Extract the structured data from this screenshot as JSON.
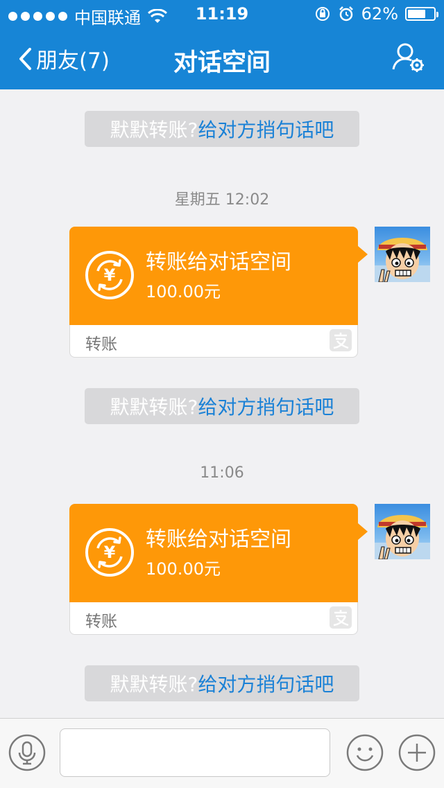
{
  "status_bar": {
    "carrier": "中国联通",
    "time": "11:19",
    "battery_text": "62%",
    "battery_level": 0.62
  },
  "nav": {
    "back_label": "朋友(7)",
    "title": "对话空间"
  },
  "prompts": [
    {
      "gray": "默默转账?",
      "link": "给对方捎句话吧"
    },
    {
      "gray": "默默转账?",
      "link": "给对方捎句话吧"
    },
    {
      "gray": "默默转账?",
      "link": "给对方捎句话吧"
    }
  ],
  "timestamps": [
    "星期五 12:02",
    "11:06"
  ],
  "transfers": [
    {
      "title": "转账给对话空间",
      "amount": "100.00元",
      "footer": "转账"
    },
    {
      "title": "转账给对话空间",
      "amount": "100.00元",
      "footer": "转账"
    }
  ],
  "colors": {
    "header": "#1785d6",
    "transfer": "#fe9808",
    "link": "#1a81d6",
    "background": "#f1f1f3"
  },
  "icons": {
    "back": "chevron-left-icon",
    "settings": "user-settings-icon",
    "coin": "yuan-coin-icon",
    "alipay": "alipay-icon",
    "voice": "microphone-icon",
    "emoji": "smiley-icon",
    "plus": "plus-icon"
  }
}
